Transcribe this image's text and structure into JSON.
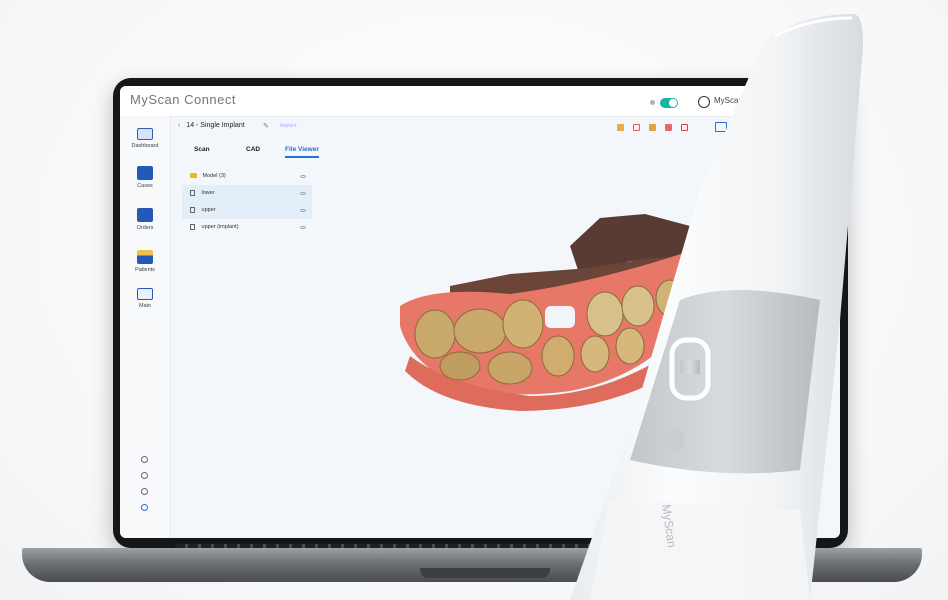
{
  "app": {
    "title": "MyScan Connect",
    "user_name": "MyScan"
  },
  "colors": {
    "accent": "#2b6ed6",
    "toggle": "#17b5a6",
    "gum": "#e77868"
  },
  "breadcrumb": {
    "case": "14 - Single Implant",
    "tag": "Implant"
  },
  "tabs": [
    {
      "label": "Scan",
      "active": false
    },
    {
      "label": "CAD",
      "active": false
    },
    {
      "label": "File Viewer",
      "active": true
    }
  ],
  "sidebar": {
    "items": [
      {
        "label": "Dashboard",
        "icon": "dashboard-icon"
      },
      {
        "label": "Cases",
        "icon": "cases-icon"
      },
      {
        "label": "Orders",
        "icon": "orders-icon"
      },
      {
        "label": "Patients",
        "icon": "patients-icon"
      },
      {
        "label": "Main",
        "icon": "monitor-icon"
      }
    ],
    "bottom_icons": [
      "settings-icon",
      "sync-icon",
      "help-icon",
      "info-icon"
    ]
  },
  "file_tree": {
    "folder": "Model (3)",
    "items": [
      "lower",
      "upper",
      "upper (implant)"
    ]
  },
  "device": {
    "brand": "MyScan"
  }
}
